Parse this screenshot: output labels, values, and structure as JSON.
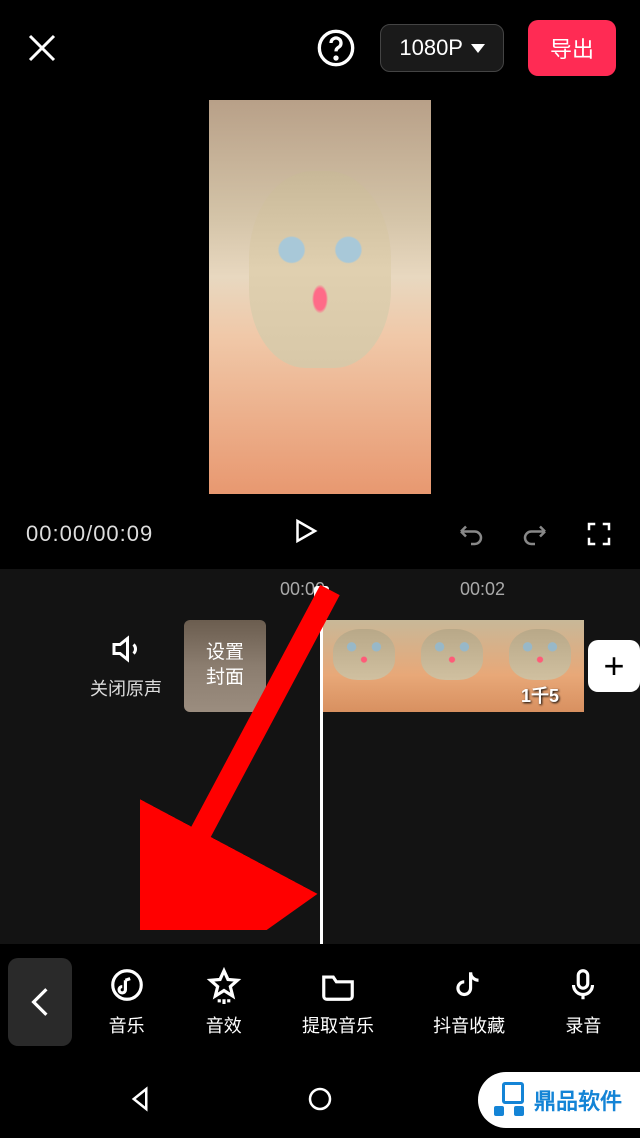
{
  "header": {
    "resolution": "1080P",
    "export_label": "导出"
  },
  "player": {
    "current_time": "00:00",
    "total_time": "00:09"
  },
  "timeline": {
    "ruler": [
      "00:00",
      "00:02"
    ],
    "mute_label": "关闭原声",
    "cover_label_line1": "设置",
    "cover_label_line2": "封面",
    "clip_price": "1千5"
  },
  "tabs": {
    "music": "音乐",
    "sfx": "音效",
    "extract": "提取音乐",
    "douyin": "抖音收藏",
    "record": "录音"
  },
  "watermark": "鼎品软件"
}
